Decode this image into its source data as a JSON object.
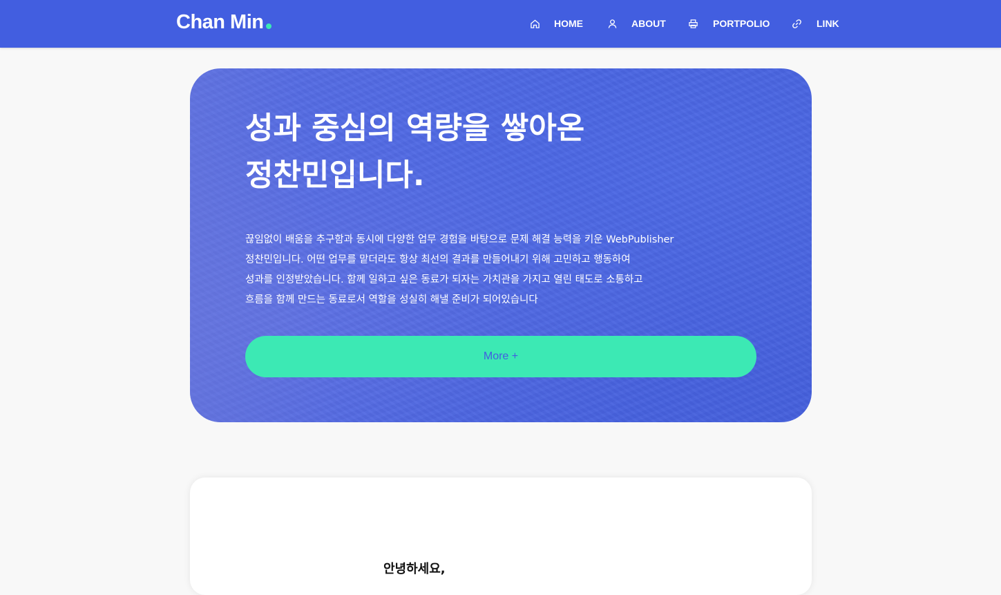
{
  "header": {
    "logo_text": "Chan Min",
    "nav": [
      {
        "label": "HOME",
        "icon": "home-icon"
      },
      {
        "label": "ABOUT",
        "icon": "user-icon"
      },
      {
        "label": "PORTPOLIO",
        "icon": "printer-icon"
      },
      {
        "label": "LINK",
        "icon": "link-icon"
      }
    ]
  },
  "hero": {
    "title_lines": [
      "성과 중심의 역량을 쌓아온",
      "정찬민입니다."
    ],
    "description_lines": [
      "끊임없이 배움을 추구함과 동시에 다양한 업무 경험을 바탕으로 문제 해결 능력을 키운 WebPublisher",
      "정찬민입니다. 어떤 업무를 맡더라도 항상 최선의 결과를 만들어내기 위해 고민하고 행동하여",
      "성과를 인정받았습니다. 함께 일하고 싶은 동료가 되자는 가치관을 가지고 열린 태도로 소통하고",
      "흐름을 함께 만드는 동료로서 역할을 성실히 해낼 준비가 되어있습니다"
    ],
    "button_label": "More +"
  },
  "about": {
    "greeting": "안녕하세요,"
  },
  "colors": {
    "primary": "#425ee0",
    "accent": "#3ce9b4",
    "background": "#f8f8f8"
  }
}
